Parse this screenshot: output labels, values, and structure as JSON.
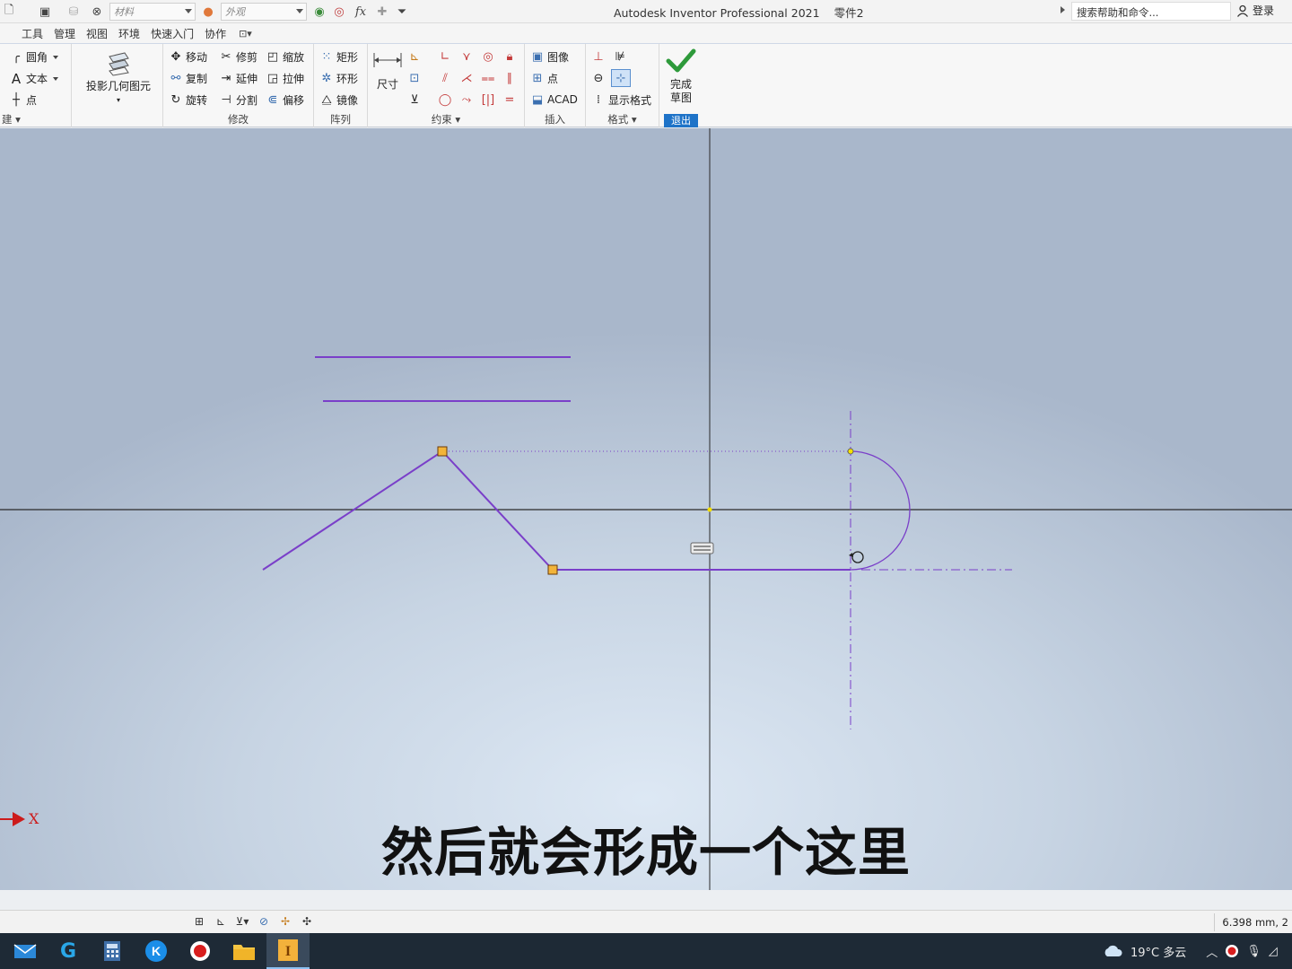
{
  "quick_access": {
    "material_placeholder": "材料",
    "appearance_placeholder": "外观",
    "fx_label": "fx"
  },
  "title": {
    "app": "Autodesk Inventor Professional 2021",
    "document": "零件2"
  },
  "search": {
    "placeholder": "搜索帮助和命令..."
  },
  "login": {
    "label": "登录"
  },
  "tabs": [
    {
      "label": "工具"
    },
    {
      "label": "管理"
    },
    {
      "label": "视图"
    },
    {
      "label": "环境"
    },
    {
      "label": "快速入门"
    },
    {
      "label": "协作"
    }
  ],
  "ribbon": {
    "create": {
      "fillet": "圆角",
      "text": "文本",
      "point": "点",
      "title": "建"
    },
    "project": {
      "label": "投影几何图元"
    },
    "modify": {
      "move": "移动",
      "trim": "修剪",
      "scale": "缩放",
      "copy": "复制",
      "extend": "延伸",
      "stretch": "拉伸",
      "rotate": "旋转",
      "split": "分割",
      "offset": "偏移",
      "title": "修改"
    },
    "pattern": {
      "rect": "矩形",
      "circular": "环形",
      "mirror": "镜像",
      "title": "阵列"
    },
    "constrain": {
      "dimension": "尺寸",
      "title": "约束"
    },
    "insert": {
      "image": "图像",
      "points": "点",
      "acad": "ACAD",
      "title": "插入"
    },
    "format": {
      "show_format": "显示格式",
      "title": "格式"
    },
    "exit": {
      "finish_line1": "完成",
      "finish_line2": "草图",
      "title": "退出"
    }
  },
  "viewport": {
    "subtitle": "然后就会形成一个这里",
    "axis_label": "X",
    "colors": {
      "sketch_line": "#7a3fc9",
      "axis": "#2a2a2a",
      "point_fill": "#f2b43a",
      "origin_point": "#f5e000"
    }
  },
  "status": {
    "coordinate": "6.398 mm, 2"
  },
  "taskbar": {
    "weather": "19°C 多云",
    "apps": [
      "mail-icon",
      "logitech-icon",
      "calculator-icon",
      "kugou-icon",
      "record-icon",
      "folder-icon",
      "inventor-icon"
    ]
  }
}
